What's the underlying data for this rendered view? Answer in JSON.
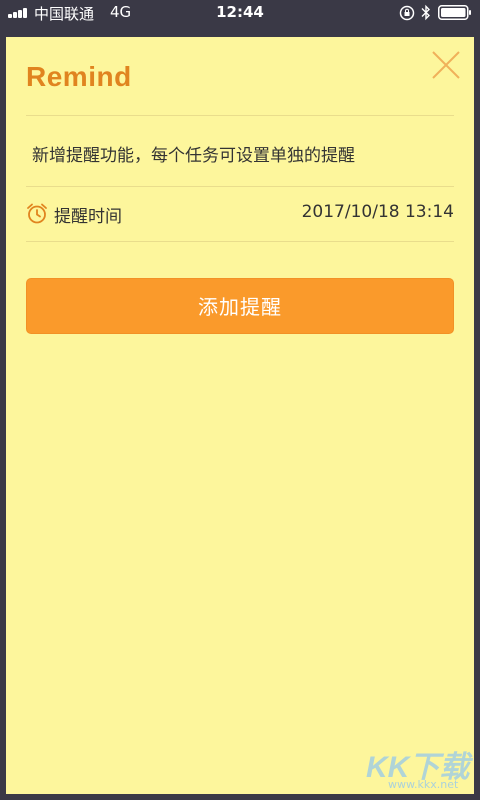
{
  "status_bar": {
    "carrier": "中国联通",
    "network": "4G",
    "time": "12:44"
  },
  "card": {
    "title": "Remind",
    "message": "新增提醒功能，每个任务可设置单独的提醒",
    "reminder_time_label": "提醒时间",
    "reminder_time_value": "2017/10/18 13:14",
    "add_button_label": "添加提醒"
  },
  "watermark": {
    "text": "KK下载",
    "url": "www.kkx.net"
  },
  "colors": {
    "card_background": "#fdf69c",
    "title": "#e0841f",
    "button": "#fa9a2b",
    "outer_background": "#3a3946"
  },
  "icons": [
    "signal-icon",
    "rotation-lock-icon",
    "bluetooth-icon",
    "battery-icon",
    "close-icon",
    "alarm-clock-icon"
  ]
}
